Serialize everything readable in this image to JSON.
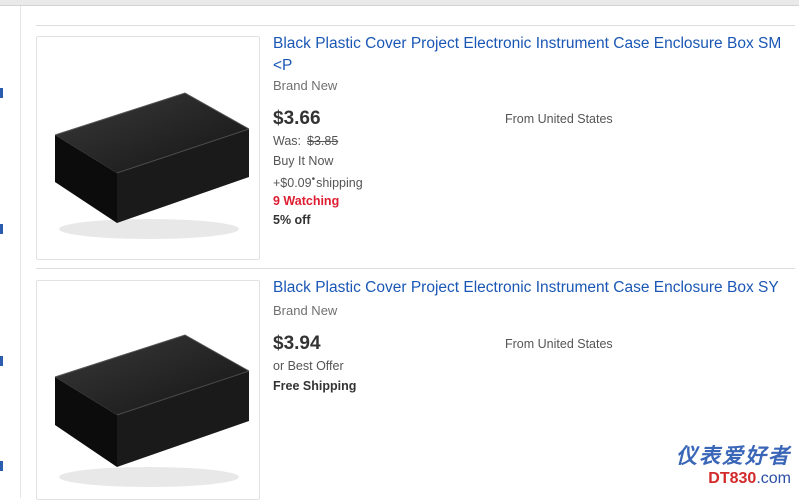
{
  "listings": [
    {
      "title": "Black Plastic Cover Project Electronic Instrument Case Enclosure Box SM <P",
      "condition": "Brand New",
      "price": "$3.66",
      "was_label": "Was:",
      "was_price": "$3.85",
      "buy_format": "Buy It Now",
      "shipping_cost": "+$0.09",
      "shipping_label": "shipping",
      "watching": "9 Watching",
      "discount": "5% off",
      "location": "From United States"
    },
    {
      "title": "Black Plastic Cover Project Electronic Instrument Case Enclosure Box SY",
      "condition": "Brand New",
      "price": "$3.94",
      "offer": "or Best Offer",
      "shipping": "Free Shipping",
      "location": "From United States"
    }
  ],
  "watermark": {
    "chinese": "仪表爱好者",
    "site_prefix": "DT830",
    "site_suffix": ".com"
  },
  "colors": {
    "link": "#1a57b5",
    "watching": "#dd1e31",
    "price": "#333333"
  }
}
